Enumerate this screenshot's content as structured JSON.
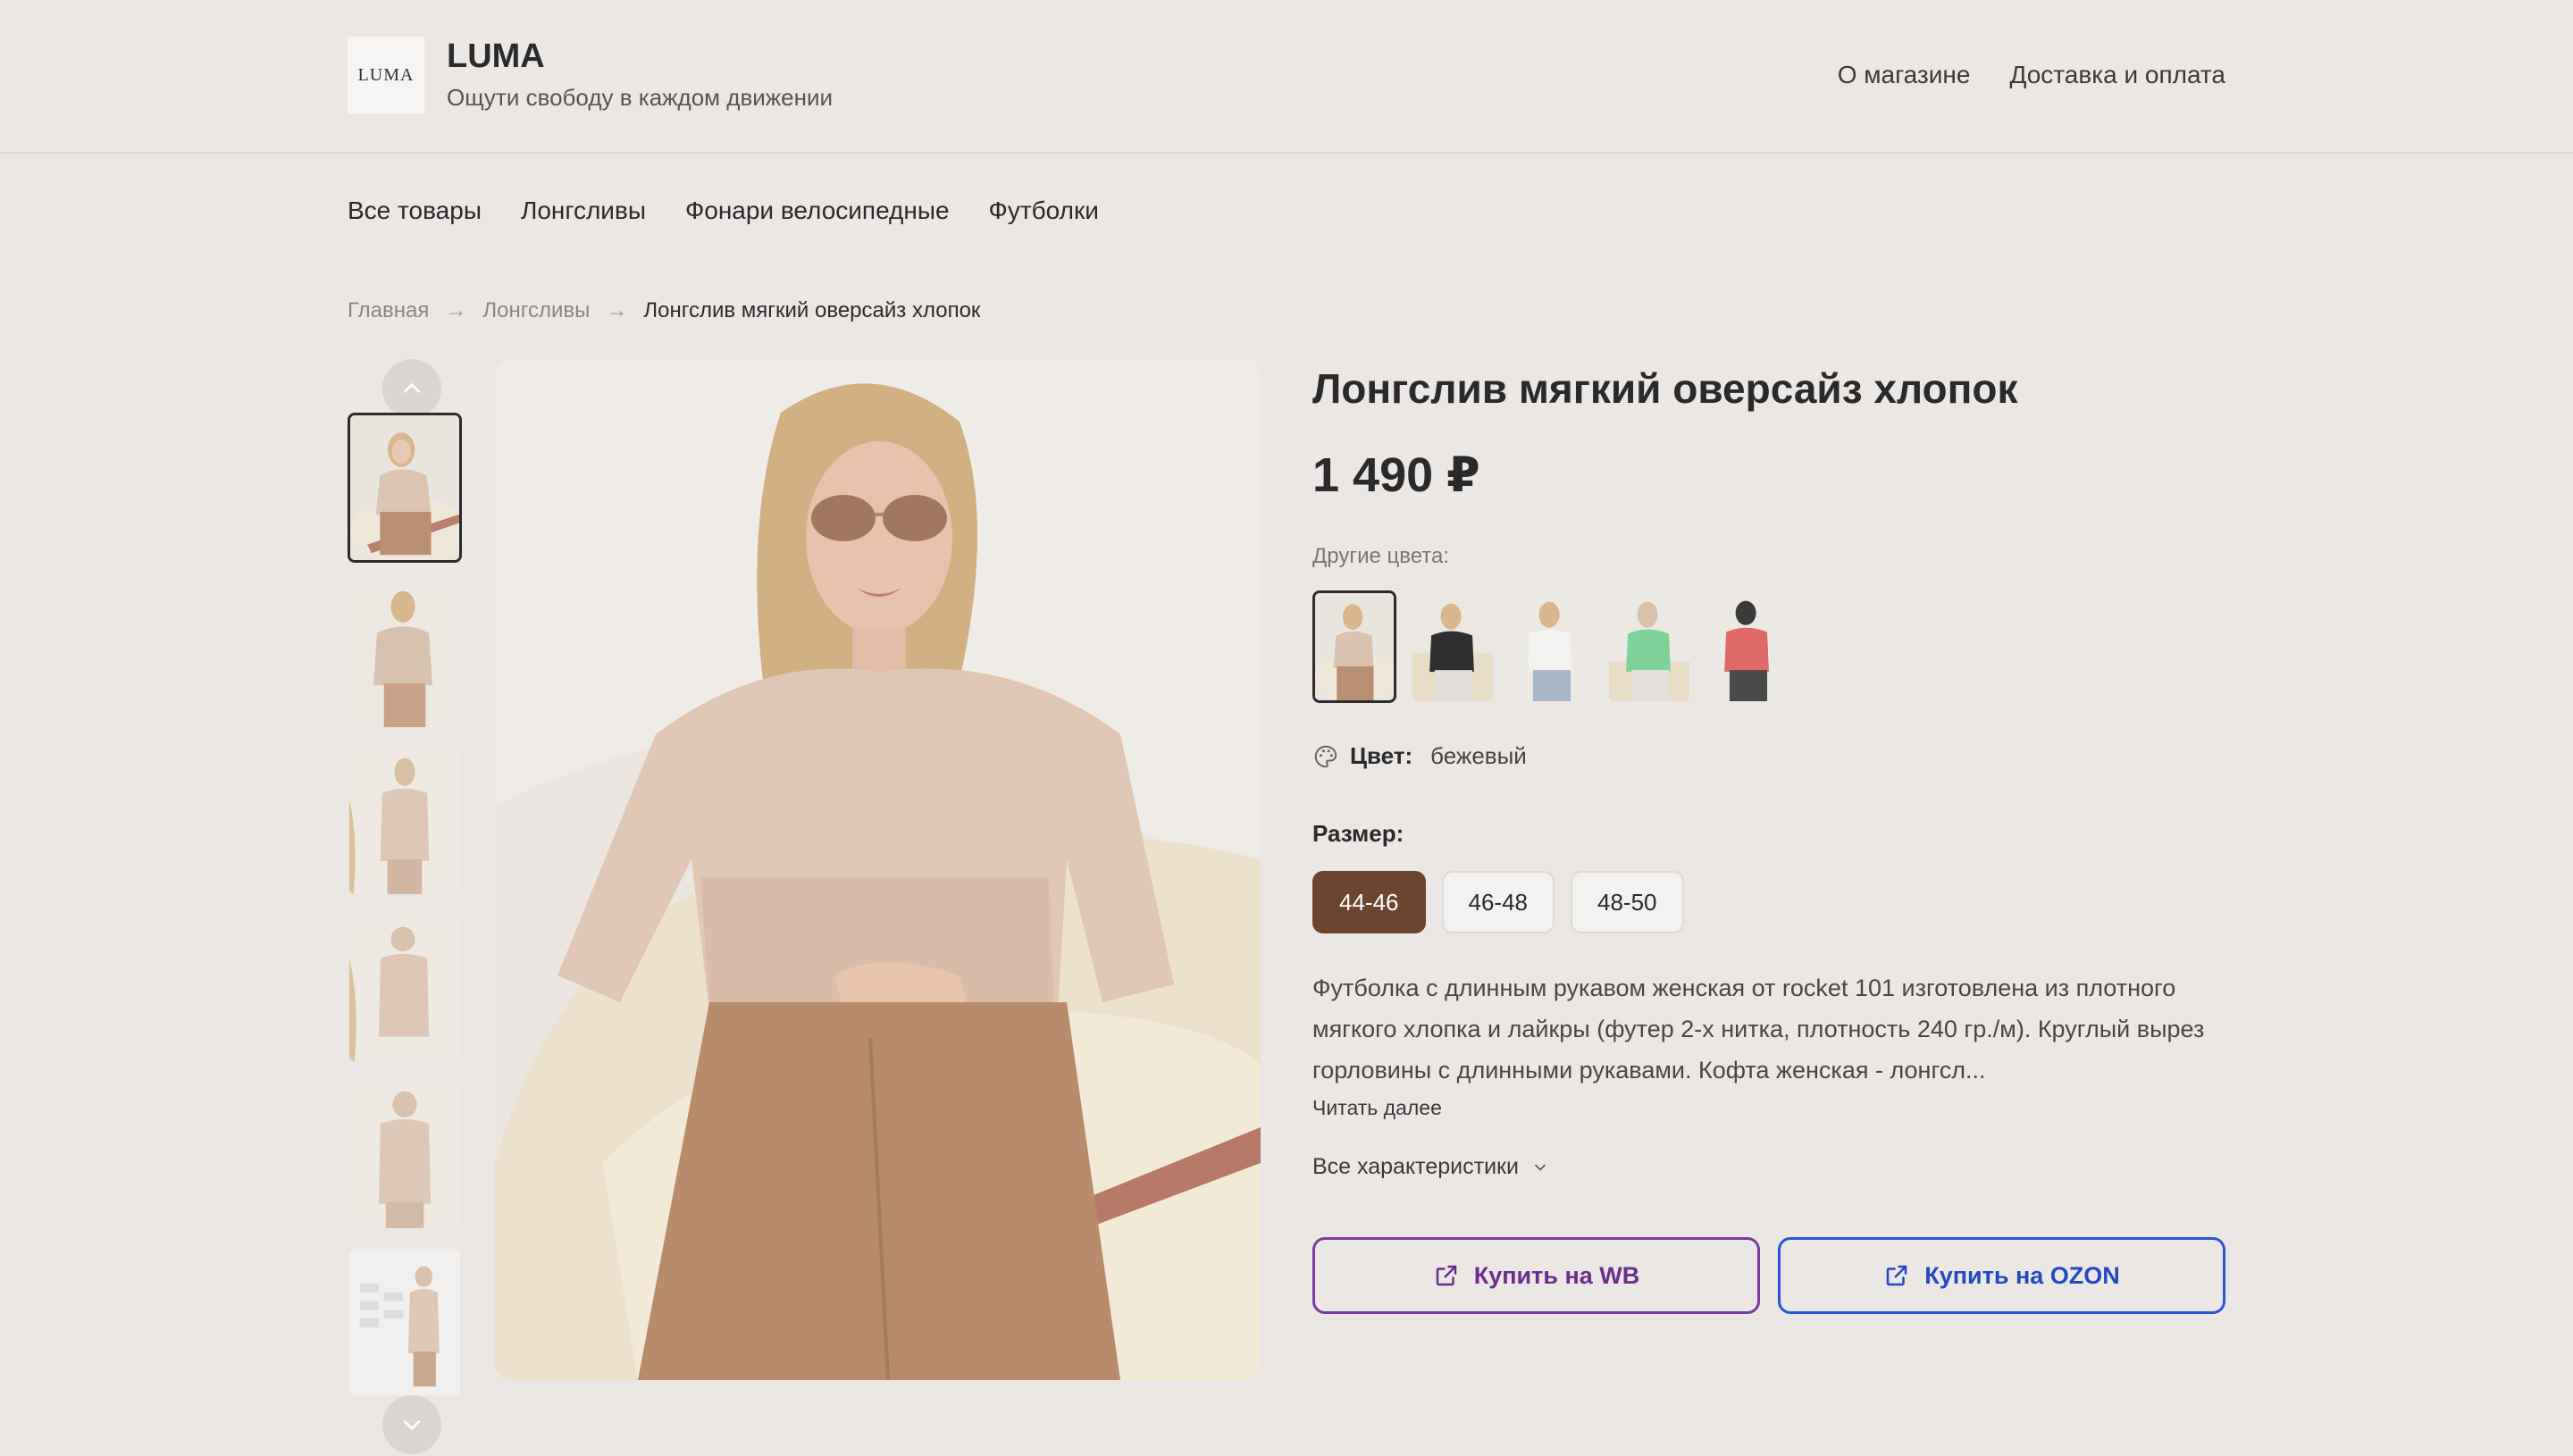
{
  "header": {
    "logo_text": "LUMA",
    "brand": "LUMA",
    "tagline": "Ощути свободу в каждом движении",
    "nav": [
      "О магазине",
      "Доставка и оплата"
    ]
  },
  "categories": [
    "Все товары",
    "Лонгсливы",
    "Фонари велосипедные",
    "Футболки"
  ],
  "breadcrumb": {
    "home": "Главная",
    "category": "Лонгсливы",
    "separator": "→",
    "current": "Лонгслив мягкий оверсайз хлопок"
  },
  "product": {
    "title": "Лонгслив мягкий оверсайз хлопок",
    "price": "1 490 ₽",
    "other_colors_label": "Другие цвета:",
    "color_label": "Цвет:",
    "color_value": "бежевый",
    "size_label": "Размер:",
    "sizes": [
      "44-46",
      "46-48",
      "48-50"
    ],
    "selected_size": "44-46",
    "description": "Футболка с длинным рукавом женская от rocket 101 изготовлена из плотного мягкого хлопка и лайкры (футер 2-х нитка, плотность 240 гр./м). Круглый вырез горловины с длинными рукавами. Кофта женская - лонгсл...",
    "read_more": "Читать далее",
    "all_specs": "Все характеристики",
    "buy_wb": "Купить на WB",
    "buy_ozon": "Купить на OZON"
  },
  "swatch_colors": [
    "#d9c2b0",
    "#2f2f2f",
    "#f2f2f0",
    "#7fd39a",
    "#e06a6a"
  ],
  "colors": {
    "accent_size": "#6b4530",
    "wb": "#7b3aa0",
    "ozon": "#2a55d8",
    "background": "#ebe7e5"
  }
}
